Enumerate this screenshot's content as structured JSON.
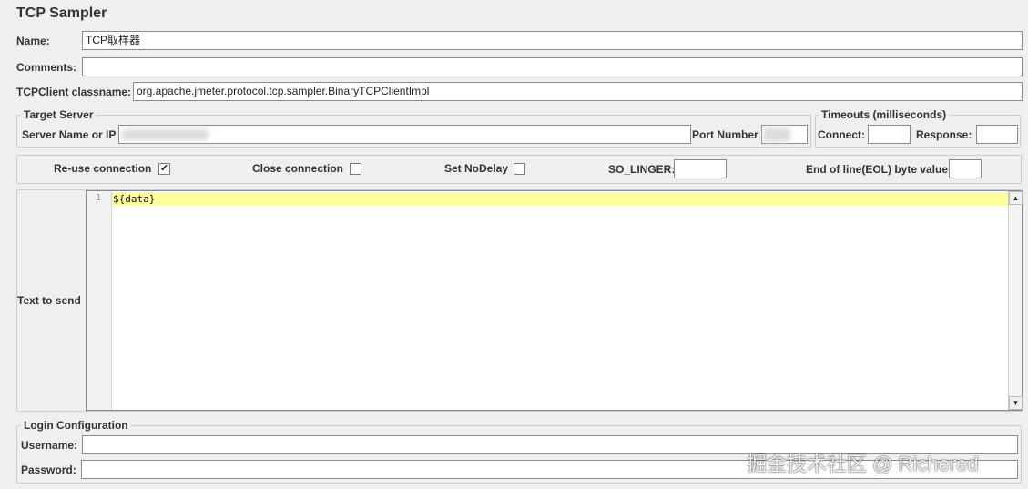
{
  "panel": {
    "title": "TCP Sampler"
  },
  "name": {
    "label": "Name:",
    "value": "TCP取样器"
  },
  "comments": {
    "label": "Comments:",
    "value": ""
  },
  "classname": {
    "label": "TCPClient classname:",
    "value": "org.apache.jmeter.protocol.tcp.sampler.BinaryTCPClientImpl"
  },
  "target_server": {
    "legend": "Target Server",
    "server_label": "Server Name or IP",
    "server_value": "",
    "port_label": "Port Number",
    "port_value": ""
  },
  "timeouts": {
    "legend": "Timeouts (milliseconds)",
    "connect_label": "Connect:",
    "connect_value": "",
    "response_label": "Response:",
    "response_value": ""
  },
  "options": {
    "reuse_label": "Re-use connection",
    "reuse_checked": true,
    "close_label": "Close connection",
    "close_checked": false,
    "nodelay_label": "Set NoDelay",
    "nodelay_checked": false,
    "solinger_label": "SO_LINGER:",
    "solinger_value": "",
    "eol_label": "End of line(EOL) byte value:",
    "eol_value": ""
  },
  "text_to_send": {
    "label": "Text to send",
    "line_number": "1",
    "code": "${data}"
  },
  "login": {
    "legend": "Login Configuration",
    "username_label": "Username:",
    "username_value": "",
    "password_label": "Password:",
    "password_value": ""
  },
  "watermark": "掘金技术社区 @ Richered",
  "icons": {
    "checkmark": "check-icon",
    "up": "arrow-up-icon",
    "down": "arrow-down-icon"
  }
}
